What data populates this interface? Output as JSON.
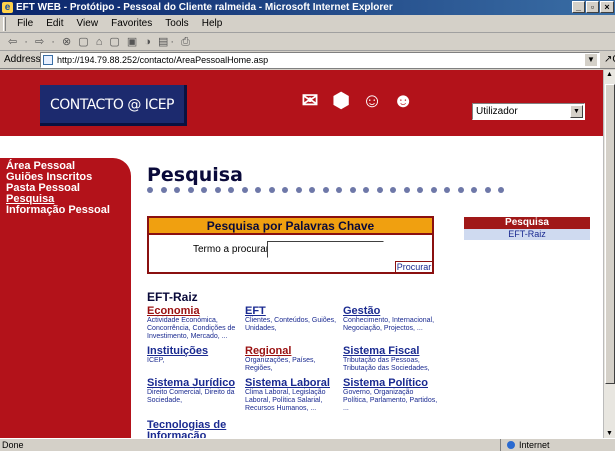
{
  "window": {
    "title": "EFT WEB - Protótipo - Pessoal do Cliente ralmeida - Microsoft Internet Explorer",
    "controls": [
      "_",
      "▫",
      "×"
    ]
  },
  "menu": [
    "File",
    "Edit",
    "View",
    "Favorites",
    "Tools",
    "Help"
  ],
  "toolbar": {
    "icons": "⇦ · ⇨ · ⊗ ▢ ⌂  ▢ ▣ ◑  ▤· ⎙"
  },
  "address": {
    "label": "Address",
    "url": "http://194.79.88.252/contacto/AreaPessoalHome.asp",
    "go": "Go"
  },
  "header": {
    "logo": "CONTACTO @ ICEP",
    "icons": [
      "mail-icon",
      "package-icon",
      "person-icon",
      "person-announce-icon"
    ],
    "icon_glyphs": [
      "✉",
      "⬢",
      "☺",
      "☻"
    ],
    "user_select": "Utilizador"
  },
  "leftnav": [
    "Área Pessoal",
    "Guiões Inscritos",
    "Pasta Pessoal",
    "Pesquisa",
    "Informação Pessoal"
  ],
  "page_title": "Pesquisa",
  "search": {
    "header": "Pesquisa por Palavras Chave",
    "label": "Termo a procurar:",
    "button": "Procurar"
  },
  "right_panel": {
    "title": "Pesquisa",
    "item": "EFT-Raiz"
  },
  "section_title": "EFT-Raiz",
  "categories": [
    {
      "title": "Economia",
      "desc": "Actividade Económica, Concorrência, Condições de Investimento, Mercado, ..."
    },
    {
      "title": "EFT",
      "desc": "Clientes, Conteúdos, Guiões, Unidades,"
    },
    {
      "title": "Gestão",
      "desc": "Conhecimento, Internacional, Negociação, Projectos, ..."
    },
    {
      "title": "Instituições",
      "desc": "ICEP,"
    },
    {
      "title": "Regional",
      "desc": "Organizações, Países, Regiões,"
    },
    {
      "title": "Sistema Fiscal",
      "desc": "Tributação das Pessoas, Tributação das Sociedades,"
    },
    {
      "title": "Sistema Jurídico",
      "desc": "Direito Comercial, Direito da Sociedade,"
    },
    {
      "title": "Sistema Laboral",
      "desc": "Clima Laboral, Legislação Laboral, Política Salarial, Recursos Humanos, ..."
    },
    {
      "title": "Sistema Político",
      "desc": "Governo, Organização Política, Parlamento, Partidos, ..."
    },
    {
      "title": "Tecnologias de Informação",
      "desc": ""
    }
  ],
  "status": {
    "text": "Done",
    "zone": "Internet"
  }
}
